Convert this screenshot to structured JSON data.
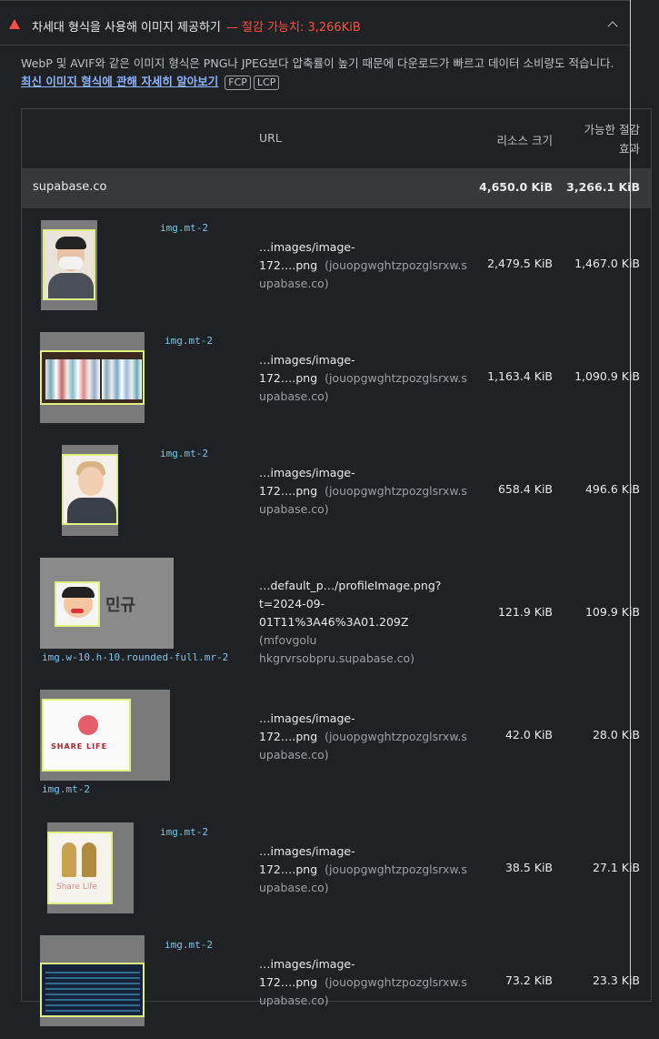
{
  "audit": {
    "title": "차세대 형식을 사용해 이미지 제공하기",
    "savings": "— 절감 가능치: 3,266KiB",
    "description": "WebP 및 AVIF와 같은 이미지 형식은 PNG나 JPEG보다 압축률이 높기 때문에 다운로드가 빠르고 데이터 소비량도 적습니다.",
    "learn_more": "최신 이미지 형식에 관해 자세히 알아보기",
    "tags": [
      "FCP",
      "LCP"
    ]
  },
  "table": {
    "headers": {
      "url": "URL",
      "size": "리소스 크기",
      "savings_line1": "가능한 절감",
      "savings_line2": "효과"
    },
    "group": {
      "name": "supabase.co",
      "size": "4,650.0 KiB",
      "savings": "3,266.1 KiB"
    },
    "rows": [
      {
        "selector": "img.mt-2",
        "url_line1": "…images/image-",
        "url_line2": "172….png",
        "host": "(jouopgwghtzpozglsrxw.s",
        "host2": "upabase.co)",
        "size": "2,479.5 KiB",
        "savings": "1,467.0 KiB"
      },
      {
        "selector": "img.mt-2",
        "url_line1": "…images/image-",
        "url_line2": "172….png",
        "host": "(jouopgwghtzpozglsrxw.s",
        "host2": "upabase.co)",
        "size": "1,163.4 KiB",
        "savings": "1,090.9 KiB"
      },
      {
        "selector": "img.mt-2",
        "url_line1": "…images/image-",
        "url_line2": "172….png",
        "host": "(jouopgwghtzpozglsrxw.s",
        "host2": "upabase.co)",
        "size": "658.4 KiB",
        "savings": "496.6 KiB"
      },
      {
        "selector": "img.w-10.h-10.rounded-full.mr-2",
        "url_line1": "…default_p…/profileImage.png?",
        "url_line2": "t=2024-09-",
        "url_line3": "01T11%3A46%3A01.209Z",
        "host": "(mfovgolu",
        "host2": "hkgrvrsobpru.supabase.co)",
        "size": "121.9 KiB",
        "savings": "109.9 KiB",
        "thumb_label": "민규"
      },
      {
        "selector": "img.mt-2",
        "url_line1": "…images/image-",
        "url_line2": "172….png",
        "host": "(jouopgwghtzpozglsrxw.s",
        "host2": "upabase.co)",
        "size": "42.0 KiB",
        "savings": "28.0 KiB",
        "thumb_label": "SHARE LIFE"
      },
      {
        "selector": "img.mt-2",
        "url_line1": "…images/image-",
        "url_line2": "172….png",
        "host": "(jouopgwghtzpozglsrxw.s",
        "host2": "upabase.co)",
        "size": "38.5 KiB",
        "savings": "27.1 KiB",
        "thumb_label": "Share Life"
      },
      {
        "selector": "img.mt-2",
        "url_line1": "…images/image-",
        "url_line2": "172….png",
        "host": "(jouopgwghtzpozglsrxw.s",
        "host2": "upabase.co)",
        "size": "73.2 KiB",
        "savings": "23.3 KiB"
      }
    ]
  },
  "colors": {
    "background": "#202124",
    "warning": "#ff4e42",
    "link": "#8ab4f8",
    "selector": "#7cc4ea",
    "highlight_border": "#e0f080"
  },
  "icons": {
    "warning": "warning-triangle-icon",
    "collapse": "chevron-up-icon"
  }
}
